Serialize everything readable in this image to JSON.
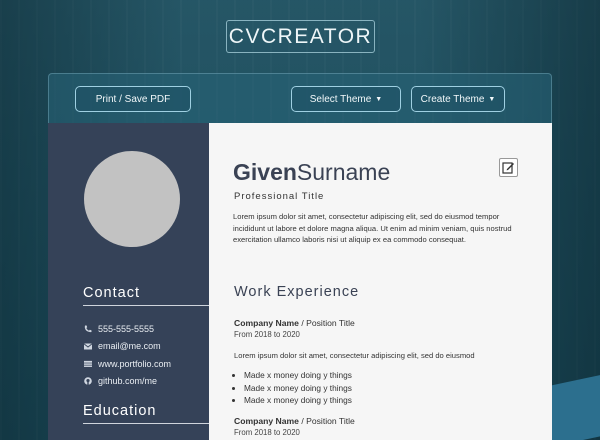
{
  "app": {
    "logo": "CVCREATOR"
  },
  "toolbar": {
    "print_label": "Print / Save PDF",
    "select_theme_label": "Select Theme",
    "create_theme_label": "Create Theme"
  },
  "sidebar": {
    "contact_heading": "Contact",
    "contacts": [
      {
        "icon": "phone-icon",
        "text": "555-555-5555"
      },
      {
        "icon": "envelope-icon",
        "text": "email@me.com"
      },
      {
        "icon": "globe-icon",
        "text": "www.portfolio.com"
      },
      {
        "icon": "github-icon",
        "text": "github.com/me"
      }
    ],
    "education_heading": "Education"
  },
  "resume": {
    "given_name": "Given",
    "surname": "Surname",
    "professional_title": "Professional Title",
    "summary": "Lorem ipsum dolor sit amet, consectetur adipiscing elit, sed do eiusmod tempor incididunt ut labore et dolore magna aliqua. Ut enim ad minim veniam, quis nostrud exercitation ullamco laboris nisi ut aliquip ex ea commodo consequat.",
    "work_heading": "Work Experience",
    "jobs": [
      {
        "company": "Company Name",
        "position": " / Position Title",
        "dates": "From 2018 to 2020",
        "description": "Lorem ipsum dolor sit amet, consectetur adipiscing elit, sed do eiusmod",
        "bullets": [
          "Made x money doing y things",
          "Made x money doing y things",
          "Made x money doing y things"
        ]
      },
      {
        "company": "Company Name",
        "position": " / Position Title",
        "dates": "From 2018 to 2020"
      }
    ]
  },
  "colors": {
    "sidebar_bg": "#354258",
    "accent": "#9fd0e2",
    "page_bg": "#f6f6f6"
  }
}
